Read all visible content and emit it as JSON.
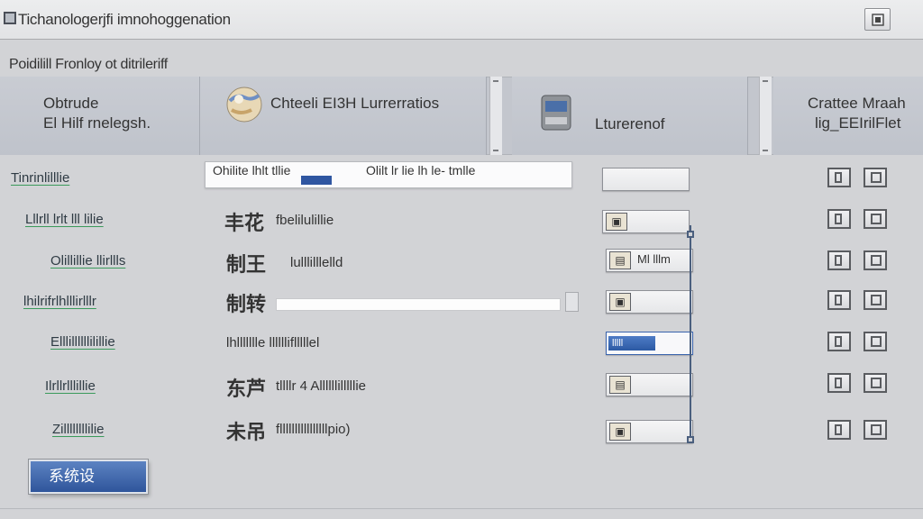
{
  "window": {
    "title": "Tichanologerjfi imnohoggenation"
  },
  "section": {
    "label": "Poidilill Fronloy ot ditrileriff"
  },
  "header": {
    "panel1": {
      "line1": "Obtrude",
      "line2": "El Hilf rnelegsh."
    },
    "panel2": {
      "label": "Chteeli EI3H Lurrerratios"
    },
    "panel3": {
      "label": "Lturerenof"
    },
    "panel4": {
      "line1": "Crattee Mraah",
      "line2": "lig_EEIrilFlet"
    }
  },
  "top_field": {
    "value_a": "Ohilite lhlt tllie",
    "value_b": "Olilt lr lie lh le- tmlle"
  },
  "rows": [
    {
      "label": "Tinrinlilllie",
      "glyph": "",
      "desc": "",
      "input": ""
    },
    {
      "label": "Lllrll lrlt lll lilie",
      "glyph": "丰花",
      "desc": "fbelilulillie",
      "input": ""
    },
    {
      "label": "Olillillie llirllls",
      "glyph": "制王",
      "desc": "lulllilllelld",
      "input": "Ml lllm"
    },
    {
      "label": "lhilrifrlhlllirlllr",
      "glyph": "制转",
      "desc": "",
      "input": ""
    },
    {
      "label": "Elllillllllilillie",
      "glyph": "",
      "desc": "lhllllllle lllllliflllllel",
      "input": ""
    },
    {
      "label": "Ilrllrlllillie",
      "glyph": "东芦",
      "desc": "tllllr 4 Allllllilllllie",
      "input": ""
    },
    {
      "label": "Zillllllllilie",
      "glyph": "未吊",
      "desc": "fllllllllllllllllpio)",
      "input": ""
    }
  ],
  "active_chip": "lllll",
  "primary_button": {
    "label": "系统设"
  },
  "colors": {
    "accent": "#2f559b",
    "underline": "#3a9a5b",
    "background": "#d2d3d6"
  }
}
